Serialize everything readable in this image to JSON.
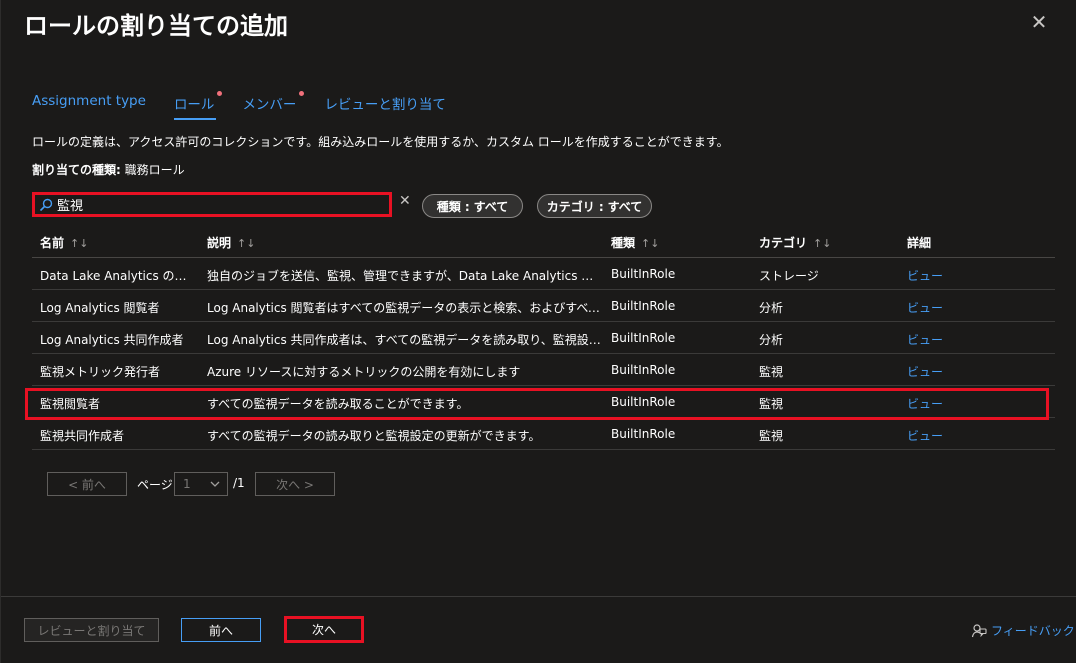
{
  "header": {
    "title": "ロールの割り当ての追加",
    "more": "···",
    "close": "✕"
  },
  "tabs": [
    {
      "label": "Assignment type",
      "active": false,
      "required": false
    },
    {
      "label": "ロール",
      "active": true,
      "required": true
    },
    {
      "label": "メンバー",
      "active": false,
      "required": true
    },
    {
      "label": "レビューと割り当て",
      "active": false,
      "required": false
    }
  ],
  "description": "ロールの定義は、アクセス許可のコレクションです。組み込みロールを使用するか、カスタム ロールを作成することができます。",
  "assignment_type": {
    "label": "割り当ての種類:",
    "value": "職務ロール"
  },
  "search": {
    "value": "監視",
    "clear": "✕"
  },
  "filters": {
    "type": {
      "label": "種類 :",
      "value": "すべて"
    },
    "category": {
      "label": "カテゴリ :",
      "value": "すべて"
    }
  },
  "columns": {
    "name": "名前",
    "description": "説明",
    "type": "種類",
    "category": "カテゴリ",
    "details": "詳細",
    "sort": "↑↓"
  },
  "rows": [
    {
      "name": "Data Lake Analytics の開...",
      "description": "独自のジョブを送信、監視、管理できますが、Data Lake Analytics アカウン...",
      "type": "BuiltInRole",
      "category": "ストレージ",
      "details": "ビュー"
    },
    {
      "name": "Log Analytics 閲覧者",
      "description": "Log Analytics 閲覧者はすべての監視データの表示と検索、およびすべての ...",
      "type": "BuiltInRole",
      "category": "分析",
      "details": "ビュー"
    },
    {
      "name": "Log Analytics 共同作成者",
      "description": "Log Analytics 共同作成者は、すべての監視データを読み取り、監視設定...",
      "type": "BuiltInRole",
      "category": "分析",
      "details": "ビュー"
    },
    {
      "name": "監視メトリック発行者",
      "description": "Azure リソースに対するメトリックの公開を有効にします",
      "type": "BuiltInRole",
      "category": "監視",
      "details": "ビュー"
    },
    {
      "name": "監視閲覧者",
      "description": "すべての監視データを読み取ることができます。",
      "type": "BuiltInRole",
      "category": "監視",
      "details": "ビュー"
    },
    {
      "name": "監視共同作成者",
      "description": "すべての監視データの読み取りと監視設定の更新ができます。",
      "type": "BuiltInRole",
      "category": "監視",
      "details": "ビュー"
    }
  ],
  "pager": {
    "prev": "< 前へ",
    "page_label": "ページ",
    "page_value": "1",
    "total": "/1",
    "next": "次へ >"
  },
  "footer": {
    "review": "レビューと割り当て",
    "prev": "前へ",
    "next": "次へ",
    "feedback": "フィードバック"
  },
  "colors": {
    "accent": "#479ef5",
    "highlight": "#e81123",
    "background": "#1b1a19"
  }
}
